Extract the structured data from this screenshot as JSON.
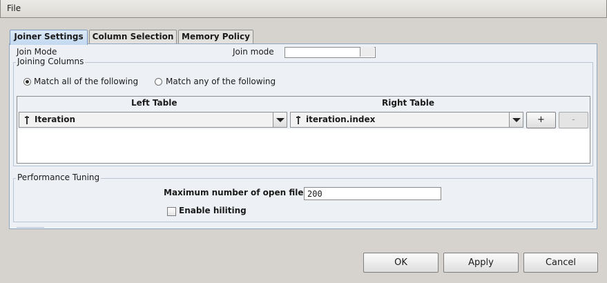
{
  "menubar": {
    "file": "File"
  },
  "tabs": [
    {
      "label": "Joiner Settings",
      "active": true
    },
    {
      "label": "Column Selection",
      "active": false
    },
    {
      "label": "Memory Policy",
      "active": false
    }
  ],
  "join_mode": {
    "label": "Join Mode",
    "field_label": "Join mode"
  },
  "joining_columns": {
    "title": "Joining Columns",
    "match_all": "Match all of the following",
    "match_any": "Match any of the following",
    "selected": "all",
    "left_header": "Left Table",
    "right_header": "Right Table",
    "left_value": "Iteration",
    "right_value": "iteration.index",
    "add_label": "+",
    "remove_label": "-"
  },
  "performance": {
    "title": "Performance Tuning",
    "max_files_label": "Maximum number of open files:",
    "max_files_value": "200",
    "hiliting_label": "Enable hiliting",
    "hiliting_checked": false
  },
  "buttons": {
    "ok": "OK",
    "apply": "Apply",
    "cancel": "Cancel"
  },
  "colors": {
    "active_tab": "#c3d8ef",
    "panel_bg": "#edf0f5",
    "window_bg": "#d6d3ce"
  }
}
